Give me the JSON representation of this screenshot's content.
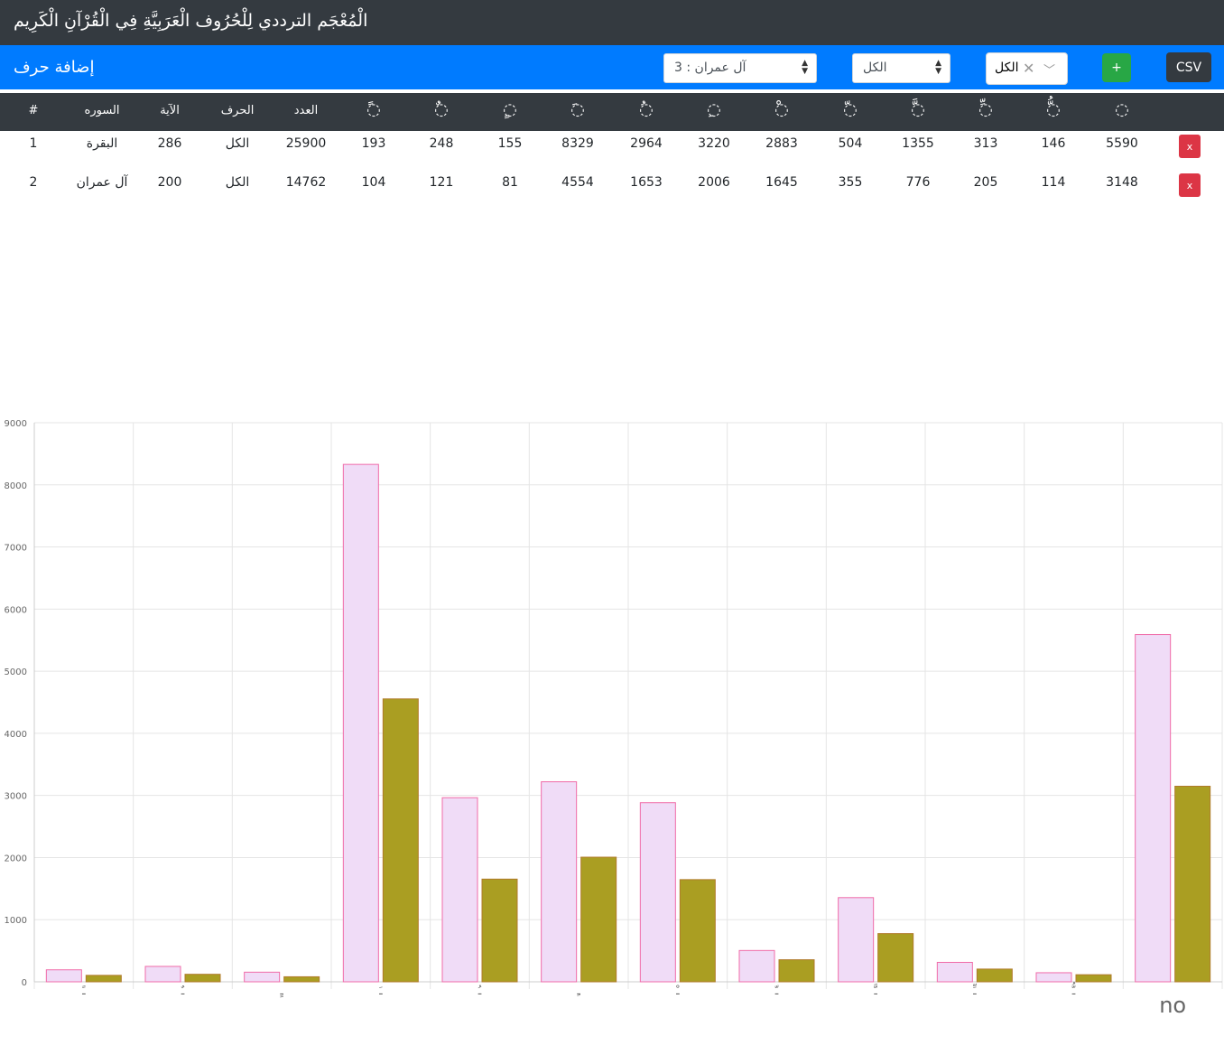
{
  "header": {
    "title": "الْمُعْجَم الترددي لِلْحُرُوف الْعَرَبِيَّةِ فِي الْقُرْآنِ الْكَرِيم"
  },
  "toolbar": {
    "heading": "إضافة حرف",
    "csv_label": "CSV",
    "add_label": "+",
    "combo_value": "الكل",
    "letter_select_value": "الكل",
    "surah_select_value": "آل عمران : 3"
  },
  "table": {
    "columns": {
      "num": "#",
      "surah": "السوره",
      "ayah": "الآية",
      "letter": "الحرف",
      "count": "العدد",
      "marks": [
        "ً",
        "ٌ",
        "ٍ",
        "َ",
        "ُ",
        "ِ",
        "ْ",
        "ّ",
        "َّ",
        "ِّ",
        "ُّ",
        ""
      ]
    },
    "delete_label": "x",
    "rows": [
      {
        "num": "1",
        "surah": "البقرة",
        "ayah": "286",
        "letter": "الكل",
        "count": "25900",
        "marks": [
          "193",
          "248",
          "155",
          "8329",
          "2964",
          "3220",
          "2883",
          "504",
          "1355",
          "313",
          "146",
          "5590"
        ]
      },
      {
        "num": "2",
        "surah": "آل عمران",
        "ayah": "200",
        "letter": "الكل",
        "count": "14762",
        "marks": [
          "104",
          "121",
          "81",
          "4554",
          "1653",
          "2006",
          "1645",
          "355",
          "776",
          "205",
          "114",
          "3148"
        ]
      }
    ]
  },
  "chart_data": {
    "type": "bar",
    "categories": [
      "ً",
      "ٌ",
      "ٍ",
      "َ",
      "ُ",
      "ِ",
      "ْ",
      "ّ",
      "َّ",
      "ِّ",
      "ُّ",
      "no"
    ],
    "series": [
      {
        "values": [
          193,
          248,
          155,
          8329,
          2964,
          3220,
          2883,
          504,
          1355,
          313,
          146,
          5590
        ],
        "fill": "#f0dcf7",
        "stroke": "#f06ba8"
      },
      {
        "values": [
          104,
          121,
          81,
          4554,
          1653,
          2006,
          1645,
          355,
          776,
          205,
          114,
          3148
        ],
        "fill": "#aa9e22",
        "stroke": "#b07a2a"
      }
    ],
    "ylim": [
      0,
      9000
    ],
    "yticks": [
      0,
      1000,
      2000,
      3000,
      4000,
      5000,
      6000,
      7000,
      8000,
      9000
    ],
    "grid": true
  }
}
